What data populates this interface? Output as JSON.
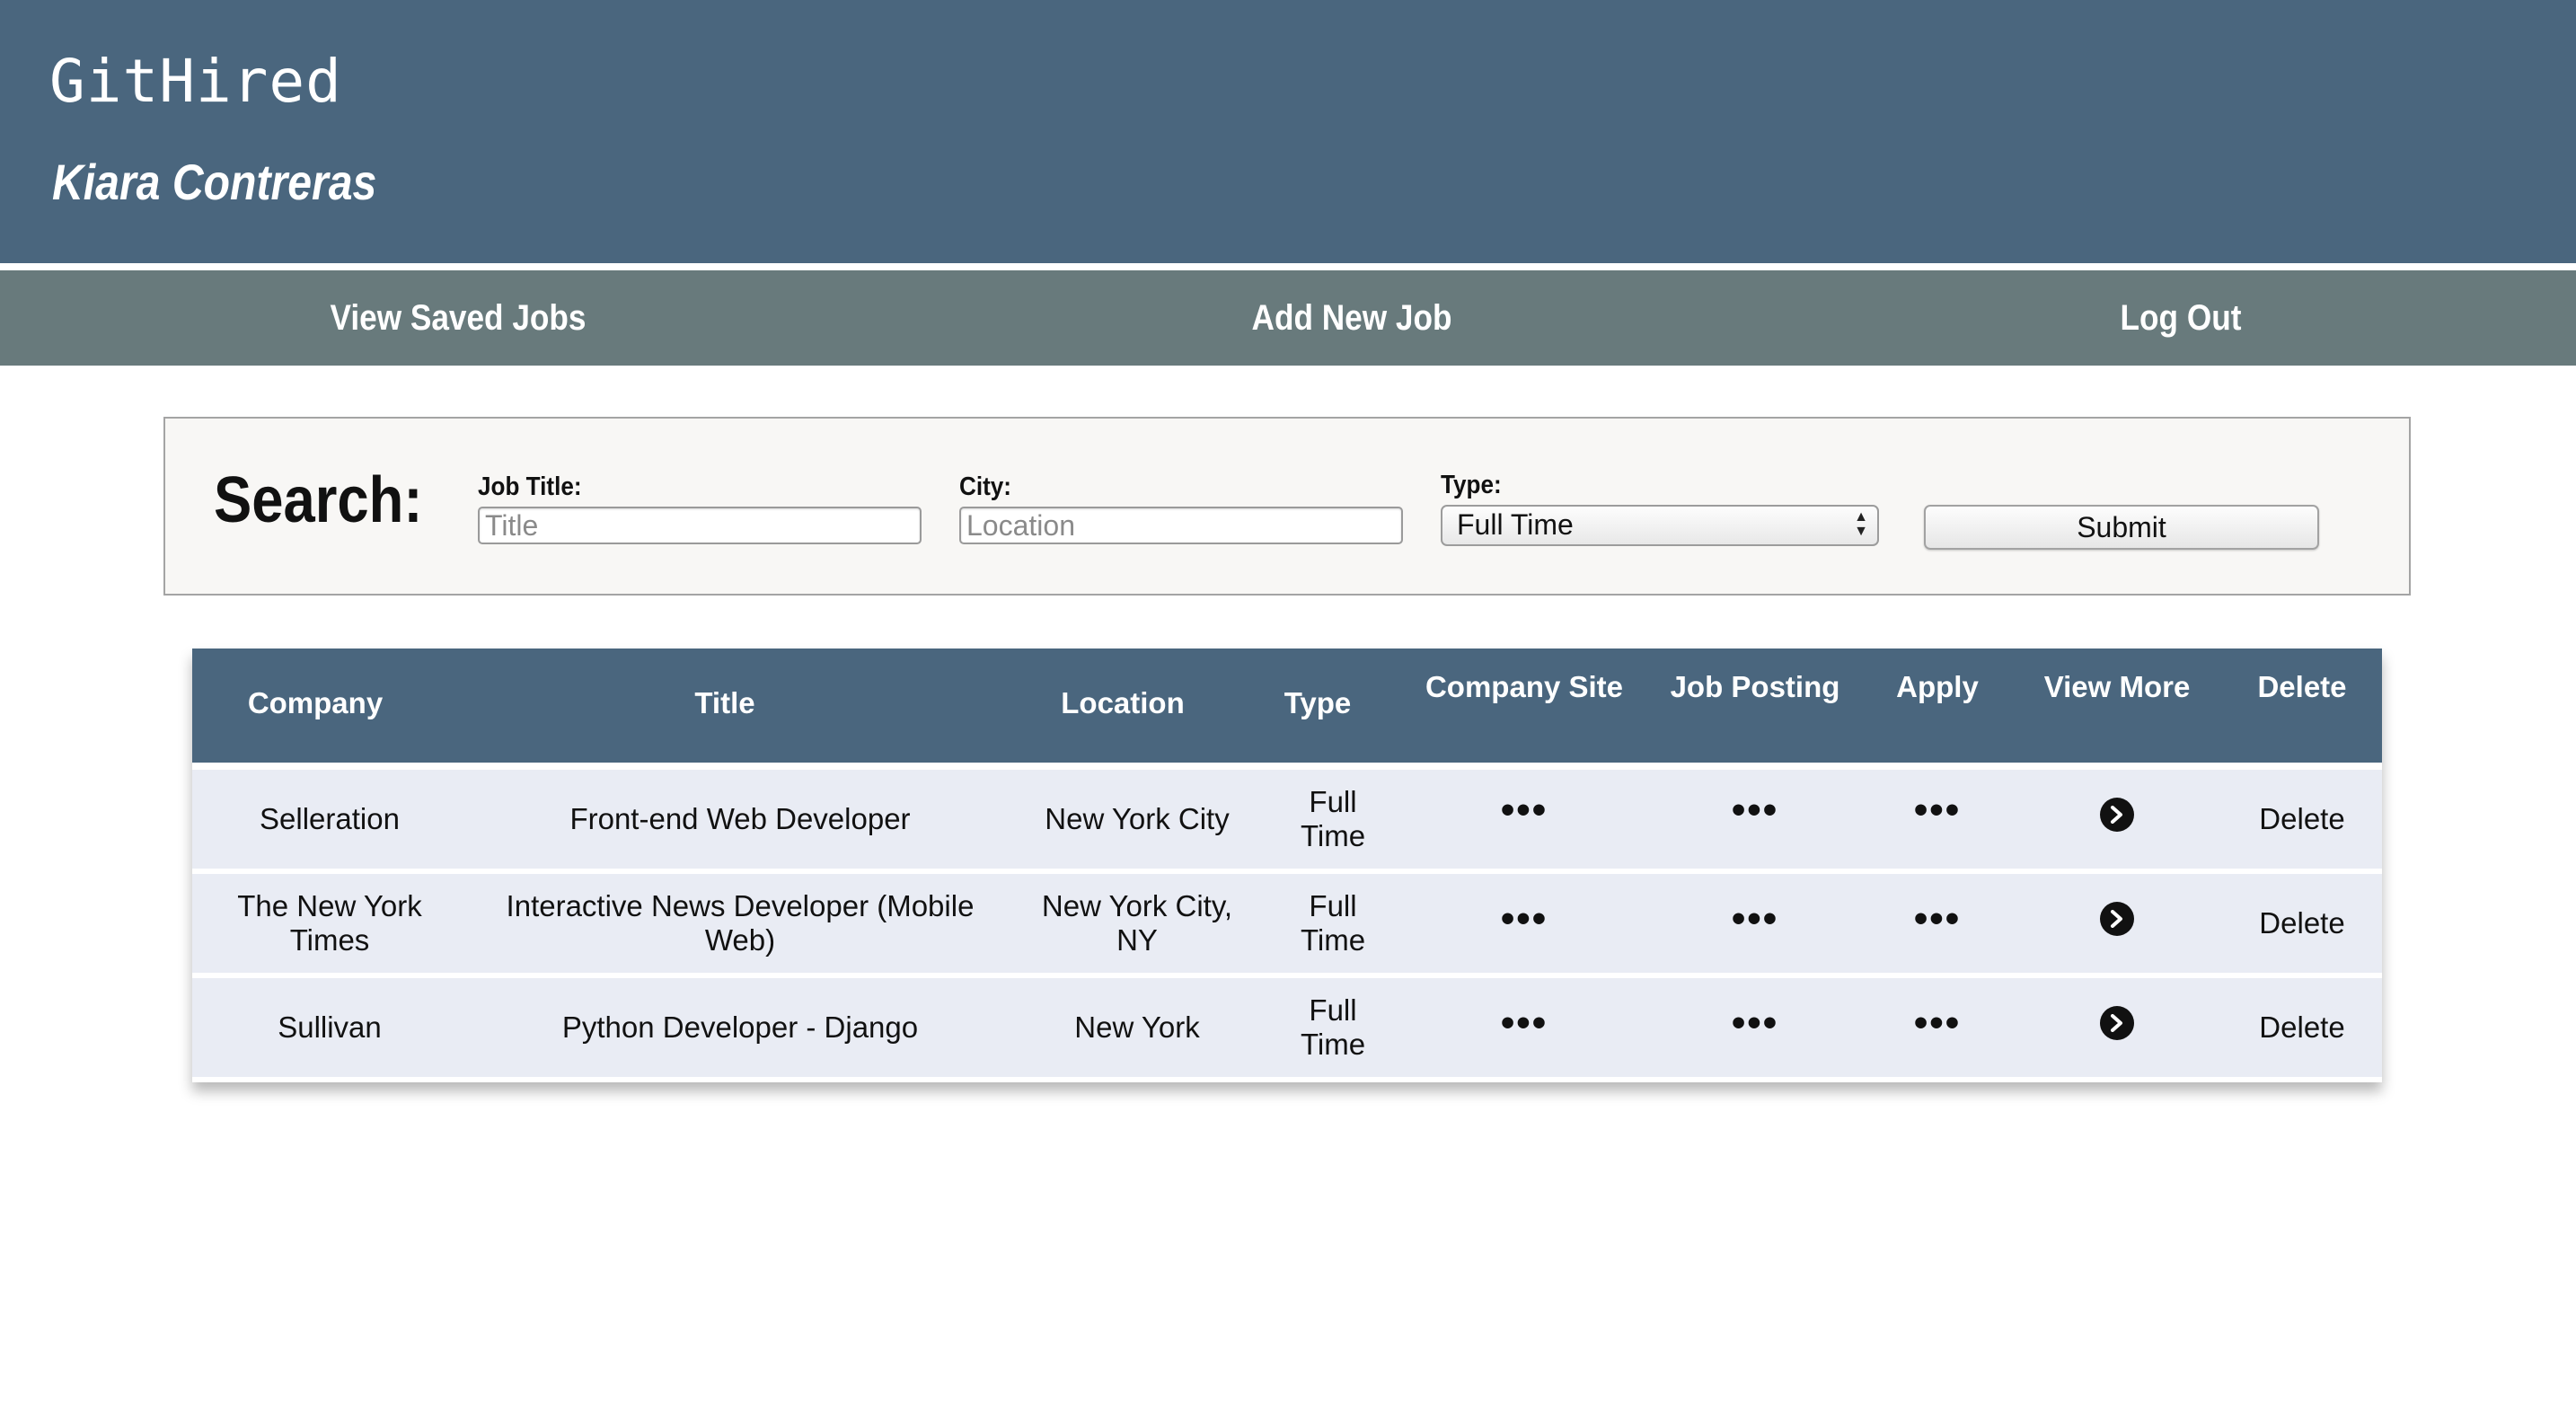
{
  "header": {
    "brand": "GitHired",
    "user_name": "Kiara Contreras"
  },
  "nav": {
    "saved_jobs": "View Saved Jobs",
    "add_job": "Add New Job",
    "log_out": "Log Out"
  },
  "search": {
    "title": "Search:",
    "job_title_label": "Job Title:",
    "job_title_placeholder": "Title",
    "city_label": "City:",
    "city_placeholder": "Location",
    "type_label": "Type:",
    "type_selected": "Full Time",
    "submit_label": "Submit"
  },
  "table": {
    "headers": [
      "Company",
      "Title",
      "Location",
      "Type",
      "Company Site",
      "Job Posting",
      "Apply",
      "View More",
      "Delete"
    ],
    "more_glyph": "•••",
    "delete_label": "Delete",
    "rows": [
      {
        "company": "Selleration",
        "title": "Front-end Web Developer",
        "location": "New York City",
        "type": "Full Time"
      },
      {
        "company": "The New York Times",
        "title": "Interactive News Developer (Mobile Web)",
        "location": "New York City, NY",
        "type": "Full Time"
      },
      {
        "company": "Sullivan",
        "title": "Python Developer - Django",
        "location": "New York",
        "type": "Full Time"
      }
    ]
  },
  "icons": {
    "more": "ellipsis-icon",
    "view_more": "chevron-right-circle-icon"
  },
  "colors": {
    "header_bg": "#4a667e",
    "nav_bg": "#687a7c",
    "row_bg": "#e9ecf4",
    "search_bg": "#f8f7f5"
  }
}
